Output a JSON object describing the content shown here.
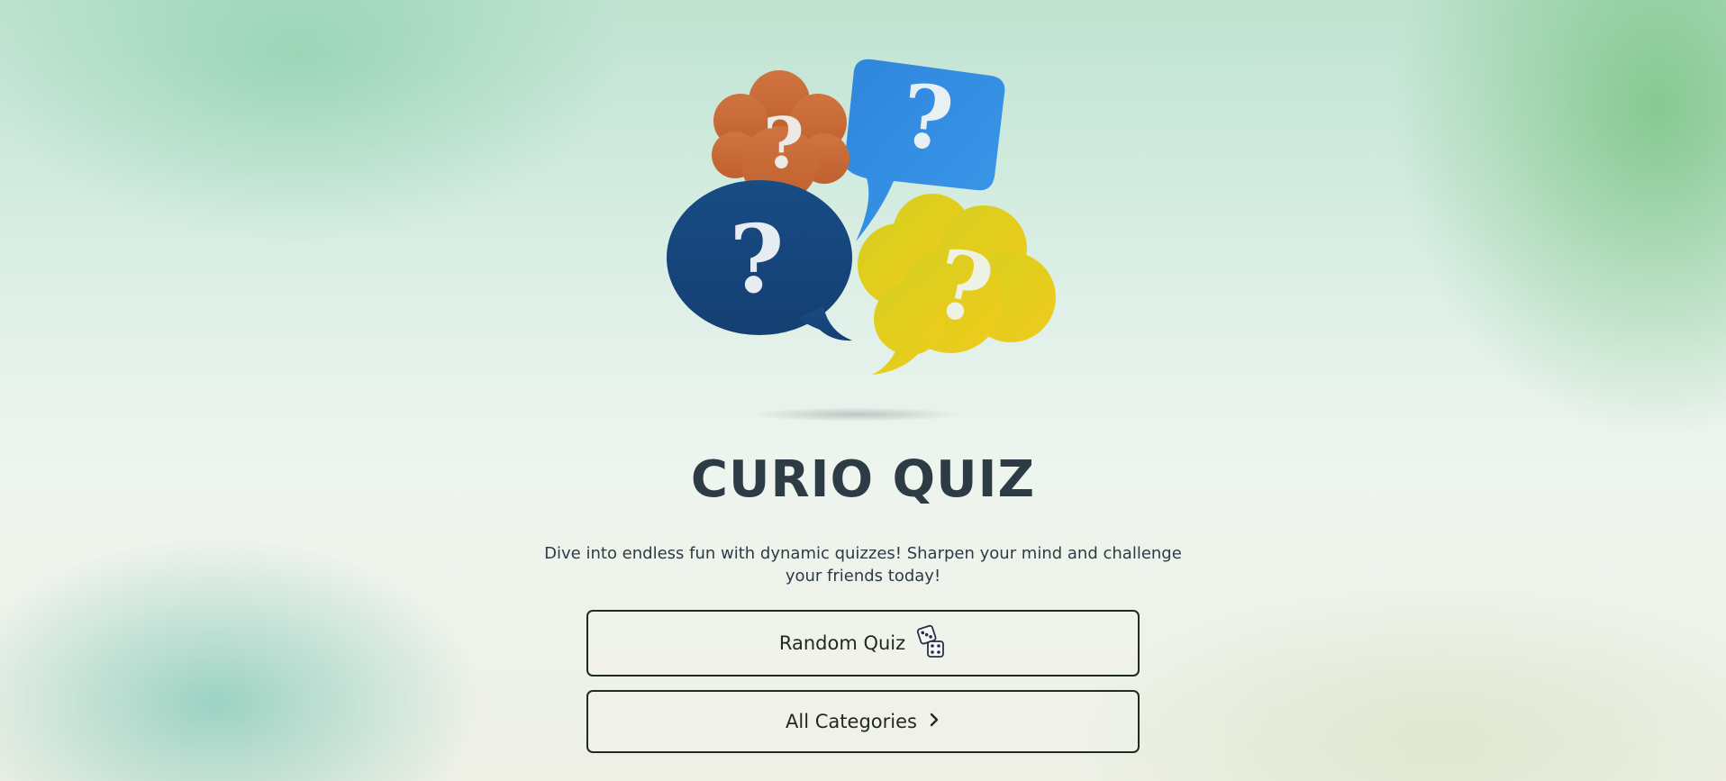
{
  "app": {
    "title": "CURIO QUIZ",
    "tagline": "Dive into endless fun with dynamic quizzes! Sharpen your mind and challenge your friends today!"
  },
  "logo": {
    "icon": "question-bubbles-icon",
    "glyph": "?",
    "colors": {
      "orange": "#c9693a",
      "light_blue": "#2f8ee0",
      "navy": "#16467f",
      "yellow": "#e6cc1c",
      "mark": "#eef0f2"
    }
  },
  "actions": {
    "random_quiz": {
      "label": "Random Quiz",
      "icon": "dice-icon"
    },
    "all_categories": {
      "label": "All Categories",
      "icon": "chevron-right-icon"
    }
  },
  "colors": {
    "text": "#2d3b45",
    "button_border": "#1f2d1f"
  }
}
